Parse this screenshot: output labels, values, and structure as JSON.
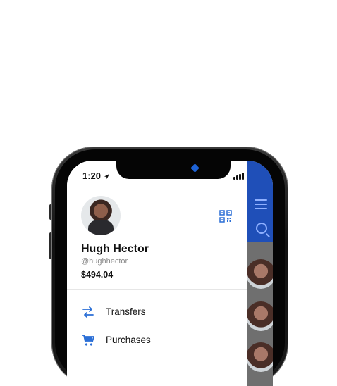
{
  "status_bar": {
    "time": "1:20"
  },
  "profile": {
    "name": "Hugh Hector",
    "handle": "@hughhector",
    "balance": "$494.04"
  },
  "menu": [
    {
      "label": "Transfers",
      "icon": "transfer-arrows-icon"
    },
    {
      "label": "Purchases",
      "icon": "shopping-cart-icon"
    }
  ],
  "colors": {
    "accent": "#1f4fb8",
    "icon_blue": "#2b6fd6"
  }
}
